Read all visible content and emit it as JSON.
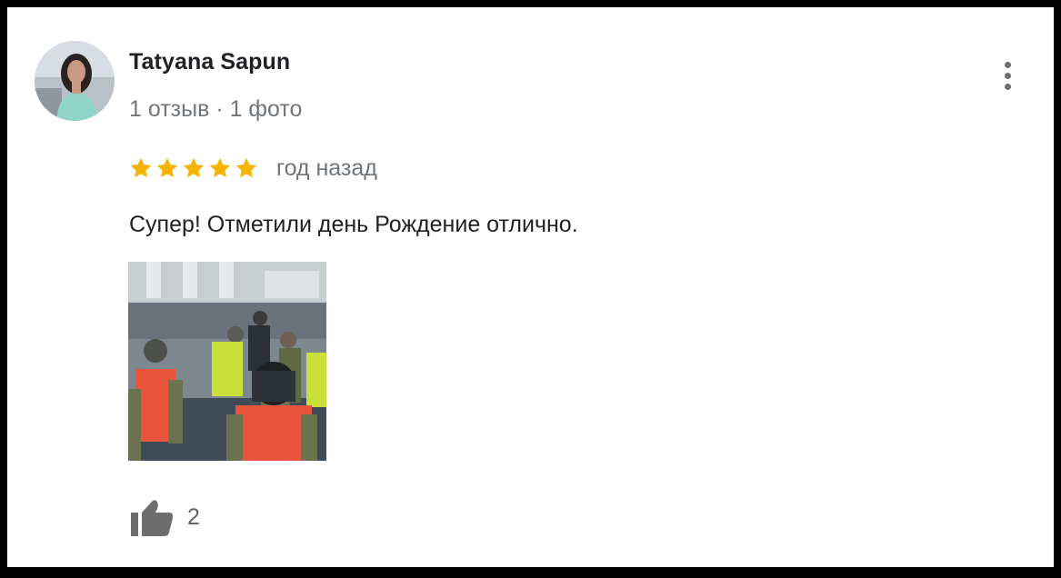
{
  "review": {
    "author_name": "Tatyana Sapun",
    "author_meta": "1 отзыв · 1 фото",
    "rating": 5,
    "rating_max": 5,
    "date": "год назад",
    "text": "Супер! Отметили день Рождение отлично.",
    "likes": "2"
  },
  "icons": {
    "more": "more-vert-icon",
    "star": "star-icon",
    "like": "thumbs-up-icon"
  },
  "colors": {
    "star": "#f4b400",
    "text_primary": "#202124",
    "text_secondary": "#70757a",
    "icon": "#6e6e6e"
  }
}
